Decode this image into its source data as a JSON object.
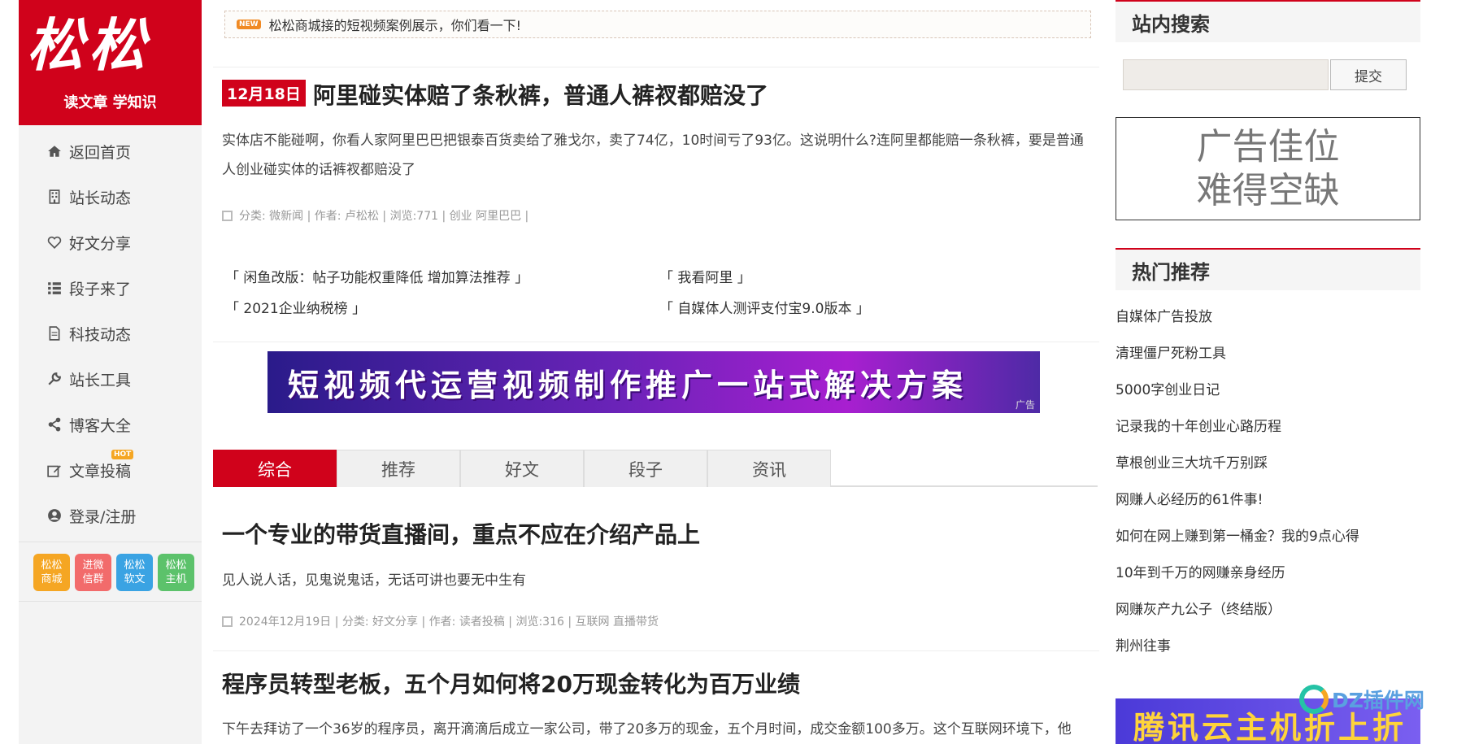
{
  "logo": {
    "big": "松松",
    "slogan": "读文章 学知识"
  },
  "nav": [
    {
      "label": "返回首页",
      "icon": "home-icon"
    },
    {
      "label": "站长动态",
      "icon": "building-icon"
    },
    {
      "label": "好文分享",
      "icon": "heart-icon"
    },
    {
      "label": "段子来了",
      "icon": "list-icon"
    },
    {
      "label": "科技动态",
      "icon": "document-icon"
    },
    {
      "label": "站长工具",
      "icon": "wrench-icon"
    },
    {
      "label": "博客大全",
      "icon": "share-icon"
    },
    {
      "label": "文章投稿",
      "icon": "edit-icon",
      "badge": "HOT"
    },
    {
      "label": "登录/注册",
      "icon": "user-icon"
    }
  ],
  "mini_links": [
    {
      "line1": "松松",
      "line2": "商城",
      "color": "#f5a623"
    },
    {
      "line1": "进微",
      "line2": "信群",
      "color": "#f26b6b"
    },
    {
      "line1": "松松",
      "line2": "软文",
      "color": "#3aa3e3"
    },
    {
      "line1": "松松",
      "line2": "主机",
      "color": "#5cc26b"
    }
  ],
  "notice": {
    "tag": "NEW",
    "text": "松松商城接的短视频案例展示，你们看一下!"
  },
  "top_article": {
    "date": "12月18日",
    "title": "阿里碰实体赔了条秋裤，普通人裤衩都赔没了",
    "excerpt": "实体店不能碰啊，你看人家阿里巴巴把银泰百货卖给了雅戈尔，卖了74亿，10时间亏了93亿。这说明什么?连阿里都能赔一条秋裤，要是普通人创业碰实体的话裤衩都赔没了",
    "meta": "分类: 微新闻 | 作者: 卢松松 | 浏览:771 | 创业 阿里巴巴 |"
  },
  "related": [
    "「 闲鱼改版：帖子功能权重降低 增加算法推荐 」",
    "「 我看阿里 」",
    "「 2021企业纳税榜 」",
    "「 自媒体人测评支付宝9.0版本 」"
  ],
  "banner": {
    "text": "短视频代运营视频制作推广一站式解决方案",
    "ad_label": "广告"
  },
  "tabs": [
    "综合",
    "推荐",
    "好文",
    "段子",
    "资讯"
  ],
  "articles": [
    {
      "title": "一个专业的带货直播间，重点不应在介绍产品上",
      "excerpt": "见人说人话，见鬼说鬼话，无话可讲也要无中生有",
      "meta": "2024年12月19日 | 分类: 好文分享 | 作者: 读者投稿 | 浏览:316 | 互联网 直播带货"
    },
    {
      "title": "程序员转型老板，五个月如何将20万现金转化为百万业绩",
      "excerpt": "下午去拜访了一个36岁的程序员，离开滴滴后成立一家公司，带了20多万的现金，五个月时间，成交金额100多万。这个互联网环境下，他"
    }
  ],
  "search": {
    "title": "站内搜索",
    "button": "提交",
    "value": ""
  },
  "ad_box": {
    "line1": "广告佳位",
    "line2": "难得空缺"
  },
  "hot": {
    "title": "热门推荐",
    "items": [
      "自媒体广告投放",
      "清理僵尸死粉工具",
      "5000字创业日记",
      "记录我的十年创业心路历程",
      "草根创业三大坑千万别踩",
      "网赚人必经历的61件事!",
      "如何在网上赚到第一桶金？我的9点心得",
      "10年到千万的网赚亲身经历",
      "网赚灰产九公子（终结版）",
      "荆州往事"
    ]
  },
  "bottom_ad": {
    "text": "腾讯云主机折上折"
  },
  "watermark": "DZ插件网"
}
